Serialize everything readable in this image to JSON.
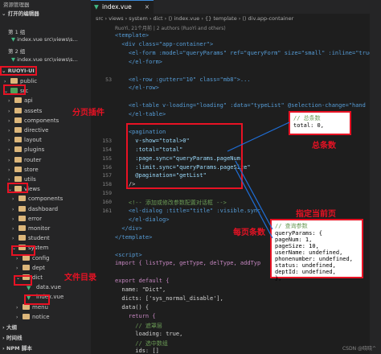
{
  "sidebar": {
    "title": "资源管理器",
    "open_editors": "打开的编辑器",
    "group1": "第 1 组",
    "open_file": "index.vue  src\\views\\s...",
    "group2": "第 2 组",
    "open_file2": "index.vue  src\\views\\s...",
    "project": "RUOYI-UI",
    "tree": [
      {
        "label": "public",
        "icon": "folder",
        "indent": 1,
        "chev": "›"
      },
      {
        "label": "src",
        "icon": "src",
        "indent": 1,
        "chev": "⌄"
      },
      {
        "label": "api",
        "icon": "folder",
        "indent": 2,
        "chev": "›"
      },
      {
        "label": "assets",
        "icon": "folder",
        "indent": 2,
        "chev": "›"
      },
      {
        "label": "components",
        "icon": "folder",
        "indent": 2,
        "chev": "›"
      },
      {
        "label": "directive",
        "icon": "folder",
        "indent": 2,
        "chev": "›"
      },
      {
        "label": "layout",
        "icon": "folder",
        "indent": 2,
        "chev": "›"
      },
      {
        "label": "plugins",
        "icon": "folder",
        "indent": 2,
        "chev": "›"
      },
      {
        "label": "router",
        "icon": "folder",
        "indent": 2,
        "chev": "›"
      },
      {
        "label": "store",
        "icon": "folder",
        "indent": 2,
        "chev": "›"
      },
      {
        "label": "utils",
        "icon": "folder",
        "indent": 2,
        "chev": "›"
      },
      {
        "label": "views",
        "icon": "folder",
        "indent": 2,
        "chev": "⌄"
      },
      {
        "label": "components",
        "icon": "folder",
        "indent": 3,
        "chev": "›"
      },
      {
        "label": "dashboard",
        "icon": "folder",
        "indent": 3,
        "chev": "›"
      },
      {
        "label": "error",
        "icon": "folder",
        "indent": 3,
        "chev": "›"
      },
      {
        "label": "monitor",
        "icon": "folder",
        "indent": 3,
        "chev": "›"
      },
      {
        "label": "student",
        "icon": "folder",
        "indent": 3,
        "chev": "›"
      },
      {
        "label": "system",
        "icon": "folder",
        "indent": 3,
        "chev": "⌄"
      },
      {
        "label": "config",
        "icon": "folder",
        "indent": 4,
        "chev": "›"
      },
      {
        "label": "dept",
        "icon": "folder",
        "indent": 4,
        "chev": "›"
      },
      {
        "label": "dict",
        "icon": "folder",
        "indent": 4,
        "chev": "⌄"
      },
      {
        "label": "data.vue",
        "icon": "vue",
        "indent": 5,
        "chev": ""
      },
      {
        "label": "index.vue",
        "icon": "vue",
        "indent": 5,
        "chev": ""
      },
      {
        "label": "menu",
        "icon": "folder",
        "indent": 4,
        "chev": "›"
      },
      {
        "label": "notice",
        "icon": "folder",
        "indent": 4,
        "chev": "›"
      }
    ],
    "outline": "大纲",
    "timeline": "时间线",
    "npm": "NPM 脚本"
  },
  "editor": {
    "tab_label": "index.vue",
    "breadcrumb": "src › views › system › dict › ⟨⟩ index.vue › {} template › ⟨⟩ div.app-container",
    "blame": "RuoYi, 21个月前 | 2 authors (RuoYi and others)",
    "lines": [
      {
        "n": "",
        "t": "<template>"
      },
      {
        "n": "",
        "t": "  <div class=\"app-container\">"
      },
      {
        "n": "",
        "t": "    <el-form :model=\"queryParams\" ref=\"queryForm\" size=\"small\" :inline=\"true\""
      },
      {
        "n": "",
        "t": "    </el-form>"
      },
      {
        "n": "",
        "t": ""
      },
      {
        "n": "53",
        "t": "    <el-row :gutter=\"10\" class=\"mb8\">..."
      },
      {
        "n": "",
        "t": "    </el-row>"
      },
      {
        "n": "",
        "t": ""
      },
      {
        "n": "",
        "t": "    <el-table v-loading=\"loading\" :data=\"typeList\" @selection-change=\"hand"
      },
      {
        "n": "",
        "t": "    </el-table>"
      },
      {
        "n": "",
        "t": ""
      },
      {
        "n": "",
        "t": "    <pagination"
      },
      {
        "n": "153",
        "t": "      v-show=\"total>0\""
      },
      {
        "n": "154",
        "t": "      :total=\"total\""
      },
      {
        "n": "155",
        "t": "      :page.sync=\"queryParams.pageNum\""
      },
      {
        "n": "156",
        "t": "      :limit.sync=\"queryParams.pageSize\""
      },
      {
        "n": "157",
        "t": "      @pagination=\"getList\""
      },
      {
        "n": "158",
        "t": "    />"
      },
      {
        "n": "159",
        "t": ""
      },
      {
        "n": "160",
        "t": "    <!-- 添加或修改参数配置对话框 -->"
      },
      {
        "n": "161",
        "t": "    <el-dialog :title=\"title\" :visible.sync"
      },
      {
        "n": "",
        "t": "    </el-dialog>"
      },
      {
        "n": "",
        "t": "  </div>"
      },
      {
        "n": "",
        "t": "</template>"
      },
      {
        "n": "",
        "t": ""
      },
      {
        "n": "",
        "t": "<script>"
      },
      {
        "n": "",
        "t": "import { listType, getType, delType, addTyp"
      },
      {
        "n": "",
        "t": ""
      },
      {
        "n": "",
        "t": "export default {"
      },
      {
        "n": "",
        "t": "  name: \"Dict\","
      },
      {
        "n": "",
        "t": "  dicts: ['sys_normal_disable'],"
      },
      {
        "n": "",
        "t": "  data() {"
      },
      {
        "n": "",
        "t": "    return {"
      },
      {
        "n": "",
        "t": "      // 遮罩层"
      },
      {
        "n": "",
        "t": "      loading: true,"
      },
      {
        "n": "",
        "t": "      // 选中数组"
      },
      {
        "n": "",
        "t": "      ids: []"
      }
    ],
    "popup_total": [
      "// 总条数",
      "total: 0,"
    ],
    "popup_query": [
      "// 查询参数",
      "queryParams: {",
      "  pageNum: 1,",
      "  pageSize: 10,",
      "  userName: undefined,",
      "  phonenumber: undefined,",
      "  status: undefined,",
      "  deptId: undefined,",
      "},"
    ]
  },
  "annotations": {
    "pagination": "分页插件",
    "total": "总条数",
    "current_page": "指定当前页",
    "page_size": "每页条数",
    "file_dir": "文件目录"
  },
  "watermark": "CSDN @晓晓^"
}
